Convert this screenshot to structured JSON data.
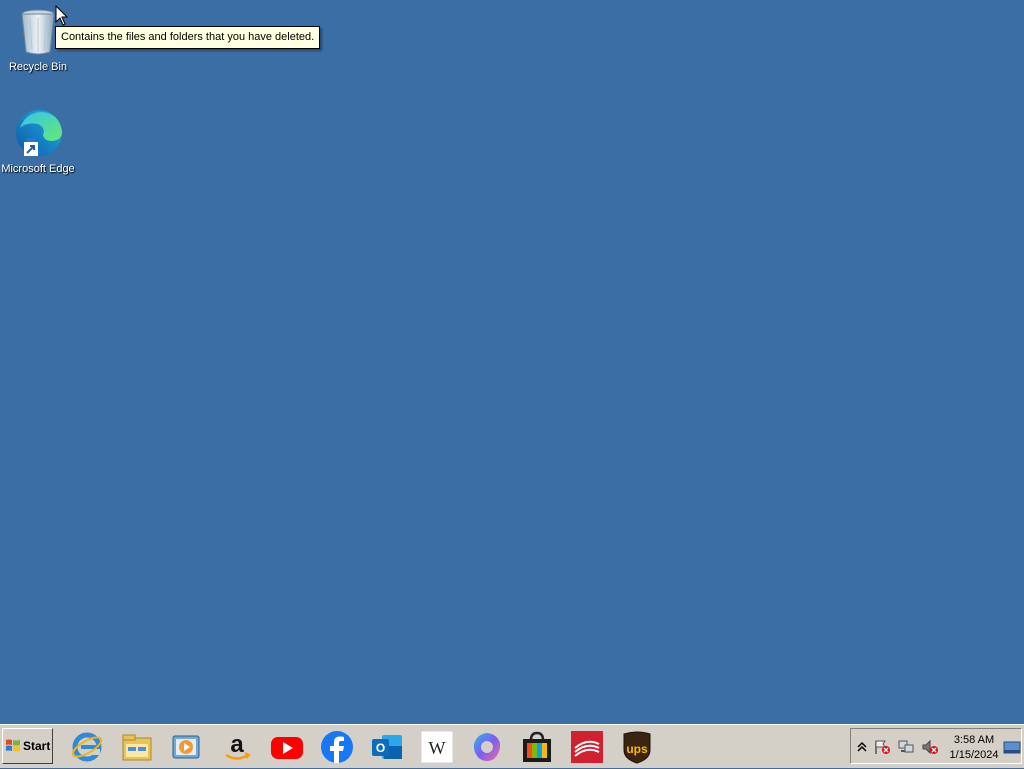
{
  "desktop": {
    "icons": [
      {
        "label": "Recycle Bin"
      },
      {
        "label": "Microsoft Edge"
      }
    ],
    "tooltip": "Contains the files and folders that you have deleted."
  },
  "taskbar": {
    "start_label": "Start",
    "quick_launch": [
      {
        "icon": "internet-explorer-icon"
      },
      {
        "icon": "file-explorer-icon"
      },
      {
        "icon": "media-player-icon"
      },
      {
        "icon": "amazon-icon"
      },
      {
        "icon": "youtube-icon"
      },
      {
        "icon": "facebook-icon"
      },
      {
        "icon": "outlook-icon"
      },
      {
        "icon": "wikipedia-icon"
      },
      {
        "icon": "copilot-icon"
      },
      {
        "icon": "store-icon"
      },
      {
        "icon": "bank-of-america-icon"
      },
      {
        "icon": "ups-icon"
      }
    ],
    "tray": {
      "time": "3:58 AM",
      "date": "1/15/2024"
    }
  },
  "colors": {
    "desktop_bg": "#3a6ea5",
    "taskbar_bg": "#d4d0c8",
    "tooltip_bg": "#ffffe1"
  }
}
